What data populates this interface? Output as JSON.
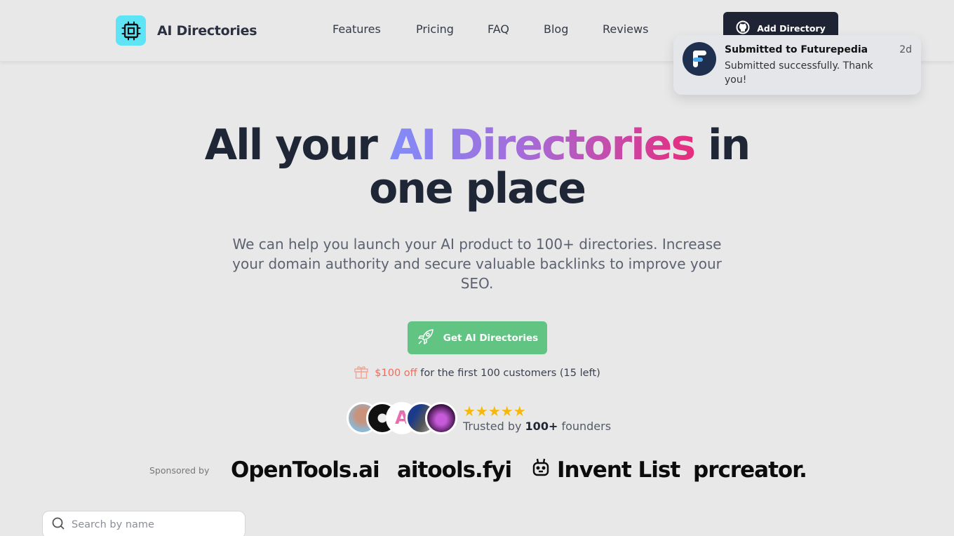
{
  "header": {
    "brand": "AI Directories",
    "nav": [
      "Features",
      "Pricing",
      "FAQ",
      "Blog",
      "Reviews"
    ],
    "add_directory_label": "Add Directory"
  },
  "toast": {
    "title": "Submitted to Futurepedia",
    "message": "Submitted successfully. Thank you!",
    "time": "2d"
  },
  "hero": {
    "title_prefix": "All your ",
    "title_highlight": "AI Directories",
    "title_suffix": " in",
    "title_line2": "one place",
    "subtitle": "We can help you launch your AI product to 100+ directories. Increase your domain authority and secure valuable backlinks to improve your SEO.",
    "cta_label": "Get AI Directories",
    "promo_off": "$100 off",
    "promo_rest": "for the first 100 customers (15 left)"
  },
  "trust": {
    "stars": "★★★★★",
    "rating": 5,
    "text_prefix": "Trusted by ",
    "text_bold": "100+",
    "text_suffix": " founders"
  },
  "sponsors": {
    "label": "Sponsored by",
    "items": [
      "OpenTools.ai",
      "aitools.fyi",
      "Invent List",
      "prcreator."
    ]
  },
  "search": {
    "placeholder": "Search by name",
    "value": ""
  },
  "colors": {
    "accent_green": "#62c483",
    "brand_cyan": "#5ee4f5",
    "dark": "#1e2434",
    "promo_red": "#ee6d5c",
    "star": "#f6b90b"
  }
}
